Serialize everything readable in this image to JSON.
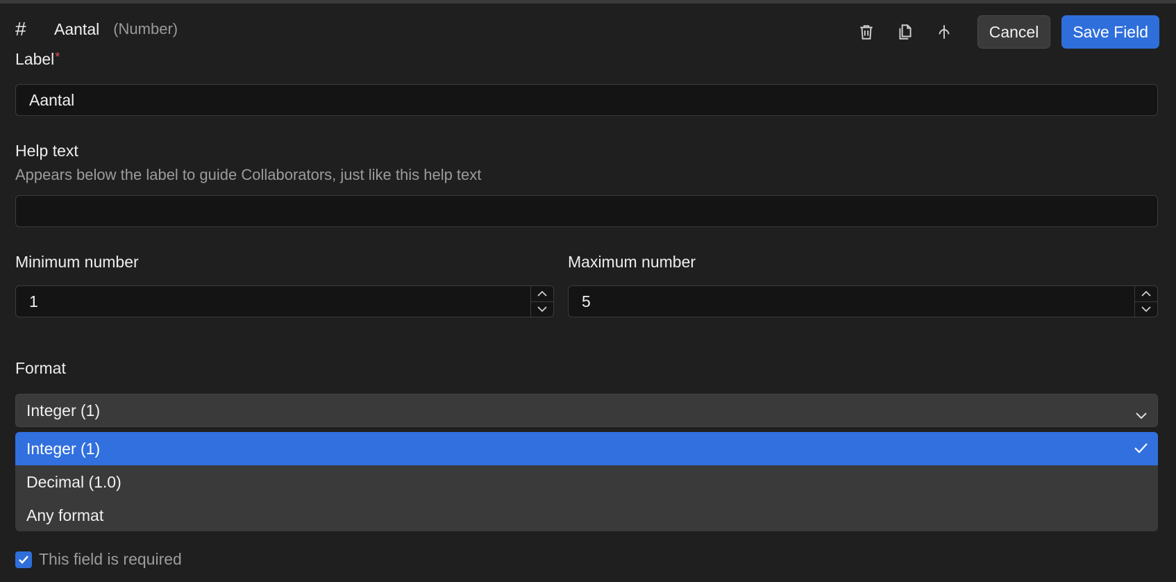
{
  "header": {
    "icon": "hash-icon",
    "icon_glyph": "#",
    "title": "Aantal",
    "type_label": "(Number)"
  },
  "toolbar": {
    "delete_icon": "trash-icon",
    "duplicate_icon": "copy-icon",
    "move_icon": "branch-icon",
    "cancel_label": "Cancel",
    "save_label": "Save Field"
  },
  "label_field": {
    "label": "Label",
    "required_mark": "*",
    "value": "Aantal"
  },
  "help_field": {
    "label": "Help text",
    "description": "Appears below the label to guide Collaborators, just like this help text",
    "value": ""
  },
  "min_field": {
    "label": "Minimum number",
    "value": "1"
  },
  "max_field": {
    "label": "Maximum number",
    "value": "5"
  },
  "format": {
    "label": "Format",
    "selected": "Integer (1)",
    "options": [
      "Integer (1)",
      "Decimal (1.0)",
      "Any format"
    ]
  },
  "required_checkbox": {
    "checked": true,
    "label": "This field is required"
  },
  "colors": {
    "background": "#1f1f1f",
    "accent": "#2f6fdb",
    "required": "#e84d4d"
  }
}
